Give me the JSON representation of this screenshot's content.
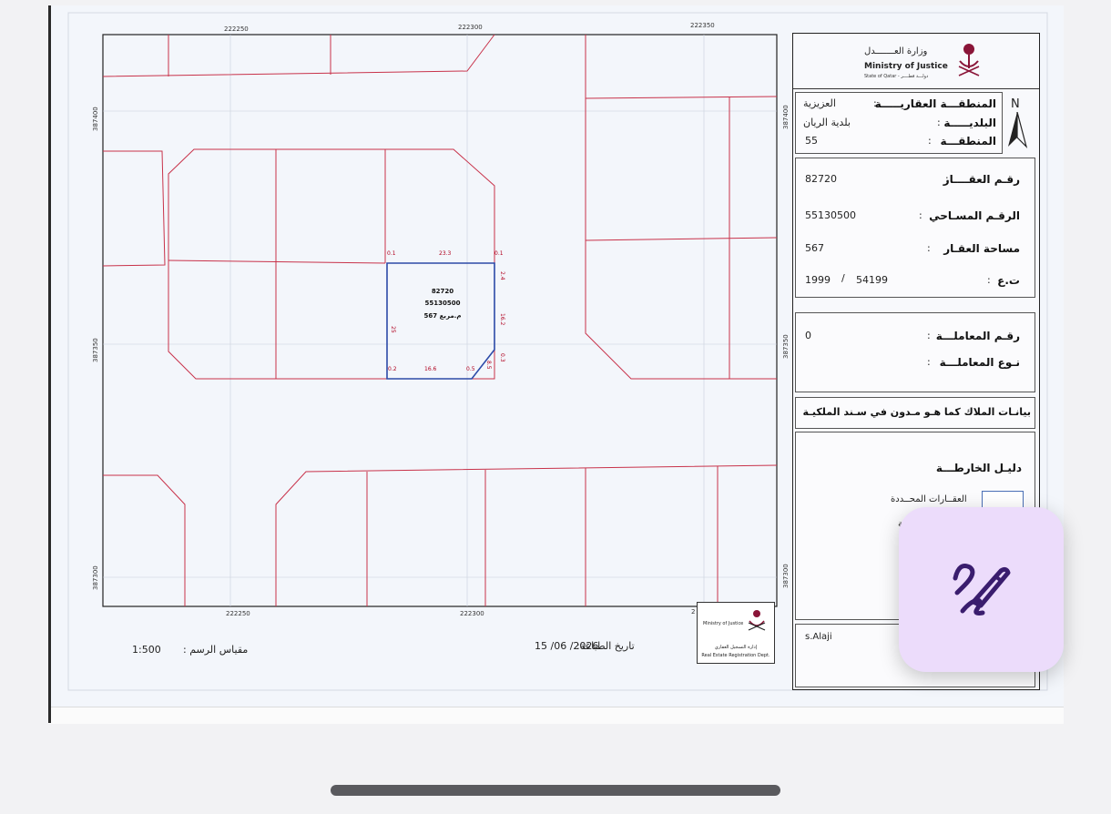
{
  "map": {
    "top_coords": [
      "222250",
      "222300",
      "222350"
    ],
    "bottom_coords": [
      "222250",
      "222300",
      "2"
    ],
    "left_coords": [
      "387400",
      "387350",
      "387300"
    ],
    "right_coords": [
      "387400",
      "387350",
      "387300"
    ],
    "plot": {
      "number": "82720",
      "survey_number": "55130500",
      "area_label": "م.مربع 567",
      "dims": {
        "top_left": "0.1",
        "top": "23.3",
        "top_right": "0.1",
        "right_top": "2.4",
        "right": "16.2",
        "right_corner": "0.3",
        "bottom_right": "8.5",
        "bottom_corner": "0.5",
        "bottom": "16.6",
        "bottom_left": "0.2",
        "left": "25"
      }
    }
  },
  "ministry": {
    "name_ar": "وزارة العـــــــدل",
    "name_en": "Ministry of Justice",
    "state": "State of Qatar - دولـــة قطــــر"
  },
  "panel": {
    "zone_label": "المنطقـــة العقاريـــــة",
    "zone_value": "العزيزية",
    "municipality_label": "البلديـــــة",
    "municipality_value": "بلدية الريان",
    "area_label": "المنطقـــة",
    "area_value": "55",
    "north": "N",
    "property_no_label": "رقـم العقــــار",
    "property_no_value": "82720",
    "survey_no_label": "الرقـم المسـاحي",
    "survey_no_value": "55130500",
    "property_area_label": "مساحة العقـار",
    "property_area_value": "567",
    "tg_label": "ت.ع",
    "tg_year": "1999",
    "tg_sep": "/",
    "tg_number": "54199",
    "transaction_no_label": "رقـم المعاملـــة",
    "transaction_no_value": "0",
    "transaction_type_label": "نـوع المعاملـــة",
    "owner_heading": "بيانـات الملاك كما هـو مـدون في سـند الملكيـة",
    "legend_title": "دليـل الخارطـــة",
    "legend_item": "العقــارات المحــددة",
    "legend_item2_partial": "ـة",
    "user": "s.Alaji"
  },
  "footer": {
    "scale_label": "مقياس الرسم :",
    "scale_value": "1:500",
    "print_date_label": "تاريخ الطباعة:",
    "print_date_value": "15 /06 /2026"
  },
  "stamp": {
    "ministry": "Ministry of Justice",
    "dept_ar": "إدارة التسجيل العقاري",
    "dept_en": "Real Estate Registration Dept."
  },
  "colors": {
    "parcel_lines": "#c8324a",
    "plot_outline": "#2c4aa8",
    "fab_bg": "#ecdcfb",
    "fab_icon": "#3a1d6e",
    "crest": "#8a1538"
  },
  "fab": {
    "icon": "pen-edit-icon"
  }
}
